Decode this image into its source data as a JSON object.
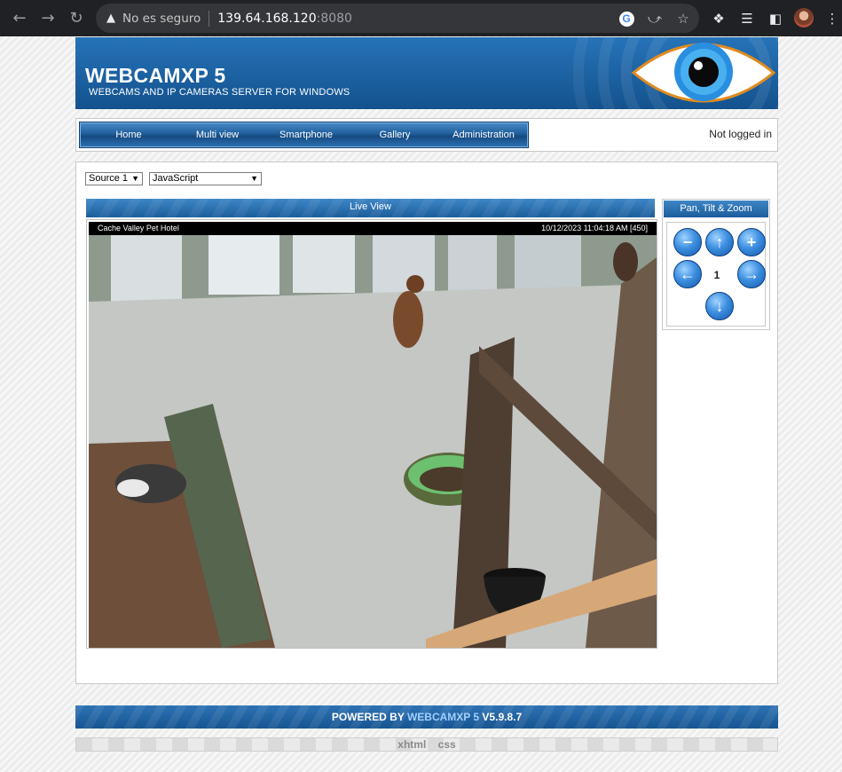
{
  "browser": {
    "security_label": "No es seguro",
    "url_host": "139.64.168.120",
    "url_port": ":8080"
  },
  "header": {
    "title": "WEBCAMXP 5",
    "subtitle": "WEBCAMS AND IP CAMERAS SERVER FOR WINDOWS"
  },
  "nav": {
    "items": [
      {
        "label": "Home"
      },
      {
        "label": "Multi view"
      },
      {
        "label": "Smartphone"
      },
      {
        "label": "Gallery"
      },
      {
        "label": "Administration"
      }
    ],
    "login_status": "Not logged in"
  },
  "controls": {
    "source_select": "Source 1",
    "mode_select": "JavaScript"
  },
  "live_view": {
    "title": "Live View",
    "osd_left": "Cache Valley Pet Hotel",
    "osd_right": "10/12/2023 11:04:18 AM  [450]"
  },
  "ptz": {
    "title": "Pan, Tilt & Zoom",
    "preset_number": "1"
  },
  "footer": {
    "powered_prefix": "POWERED BY ",
    "brand": "WEBCAMXP 5",
    "version": " V5.9.8.7",
    "links": [
      "xhtml",
      "css"
    ]
  },
  "colors": {
    "header_blue": "#1b5fa0",
    "accent_link": "#9fd0ff"
  }
}
